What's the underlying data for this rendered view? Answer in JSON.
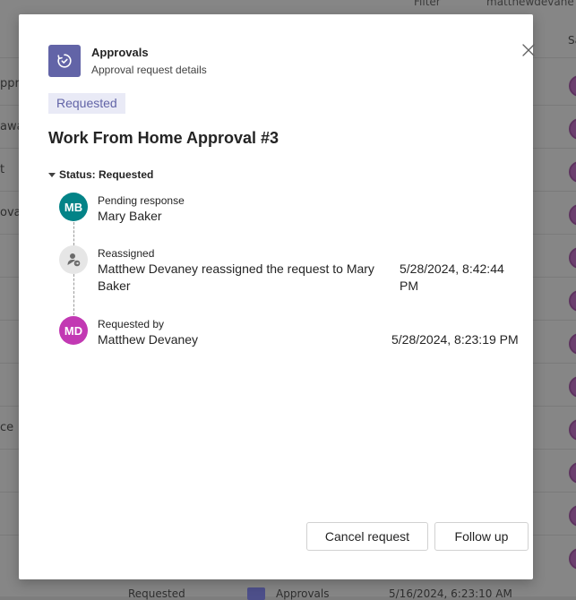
{
  "background": {
    "top_filter": "Filter",
    "top_user": "matthewdevane",
    "right_header": "Sa",
    "left_fragments": [
      "ppro",
      "awa",
      "t",
      "ova",
      "ce"
    ],
    "bottom_left": "Requested",
    "bottom_mid": "Approvals",
    "bottom_right": "5/16/2024, 6:23:10 AM"
  },
  "dialog": {
    "app_title": "Approvals",
    "app_subtitle": "Approval request details",
    "status_badge": "Requested",
    "request_title": "Work From Home Approval #3",
    "status_section": "Status: Requested",
    "timeline": [
      {
        "initials": "MB",
        "avatar_color": "#038387",
        "label": "Pending response",
        "text": "Mary Baker",
        "date": ""
      },
      {
        "initials": "",
        "avatar_color": "#e6e6e6",
        "icon": "person-swap-icon",
        "label": "Reassigned",
        "text_line1": "Matthew Devaney reassigned the request to Mary",
        "text_line2": "Baker",
        "date_line1": "5/28/2024, 8:42:44",
        "date_line2": "PM"
      },
      {
        "initials": "MD",
        "avatar_color": "#c239b3",
        "label": "Requested by",
        "text": "Matthew Devaney",
        "date": "5/28/2024, 8:23:19 PM"
      }
    ],
    "buttons": {
      "cancel": "Cancel request",
      "follow_up": "Follow up"
    }
  },
  "colors": {
    "brand": "#6264a7",
    "badge_bg": "#e9eaf6"
  }
}
